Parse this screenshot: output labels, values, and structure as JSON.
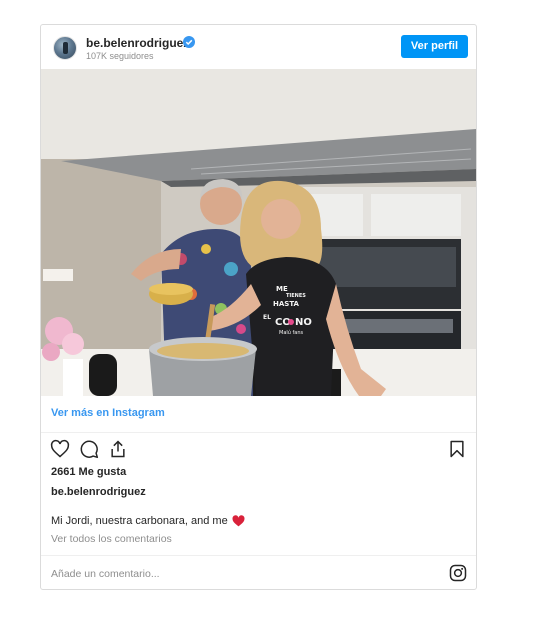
{
  "post": {
    "username": "be.belenrodriguez",
    "followers": "107K seguidores",
    "view_profile": "Ver perfil",
    "view_more": "Ver más en Instagram",
    "likes": "2661 Me gusta",
    "caption_user": "be.belenrodriguez",
    "caption": "Mi Jordi, nuestra carbonara, and me",
    "view_comments": "Ver todos los comentarios",
    "comment_placeholder": "Añade un comentario...",
    "photo_shirt_text": [
      "ME",
      "TIENES",
      "HASTA",
      "EL",
      "CO",
      "NO",
      "Malú fans"
    ]
  },
  "icons": {
    "verified": "verified-badge-icon",
    "like": "heart-icon",
    "comment": "comment-bubble-icon",
    "share": "share-icon",
    "save": "bookmark-icon",
    "instagram": "instagram-logo-icon",
    "caption_emoji": "red-heart-icon"
  },
  "colors": {
    "accent": "#0095f6",
    "link": "#3897f0",
    "heart": "#e0245e"
  }
}
